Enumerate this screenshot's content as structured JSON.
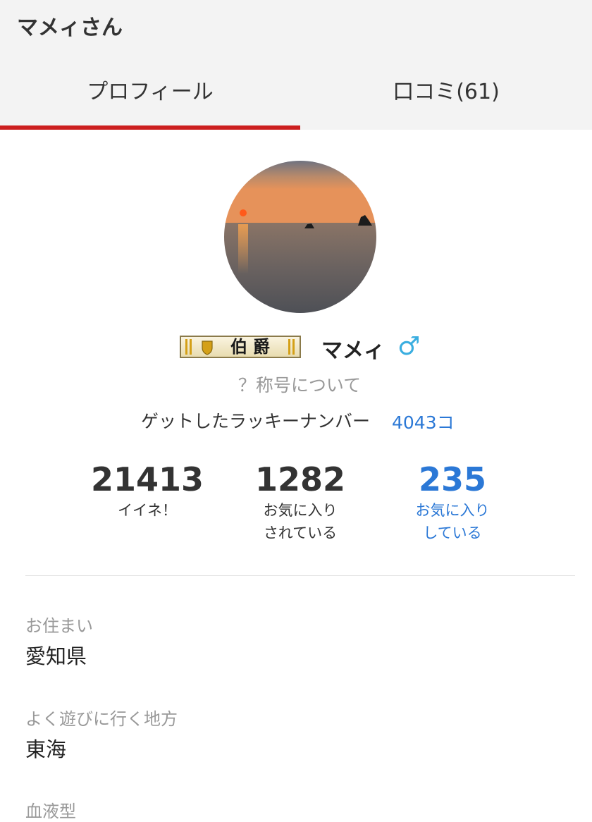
{
  "header": {
    "title": "マメィさん",
    "tabs": [
      {
        "label": "プロフィール",
        "active": true
      },
      {
        "label": "口コミ(61)",
        "active": false
      }
    ],
    "accent_color": "#cc1f1f"
  },
  "profile": {
    "avatar_description_icon": "avatar-sunset-photo",
    "title_badge": "伯爵",
    "nickname": "マメィ",
    "gender_symbol": "♂",
    "title_link": "？称号について",
    "lucky_number_label": "ゲットしたラッキーナンバー",
    "lucky_number_value": "4043コ"
  },
  "stats": [
    {
      "value": "21413",
      "label": "イイネ！"
    },
    {
      "value": "1282",
      "label": "お気に入り\nされている"
    },
    {
      "value": "235",
      "label": "お気に入り\nしている"
    }
  ],
  "details": [
    {
      "label": "お住まい",
      "value": "愛知県"
    },
    {
      "label": "よく遊びに行く地方",
      "value": "東海"
    },
    {
      "label": "血液型",
      "value": ""
    }
  ],
  "link_color": "#2b78d6"
}
